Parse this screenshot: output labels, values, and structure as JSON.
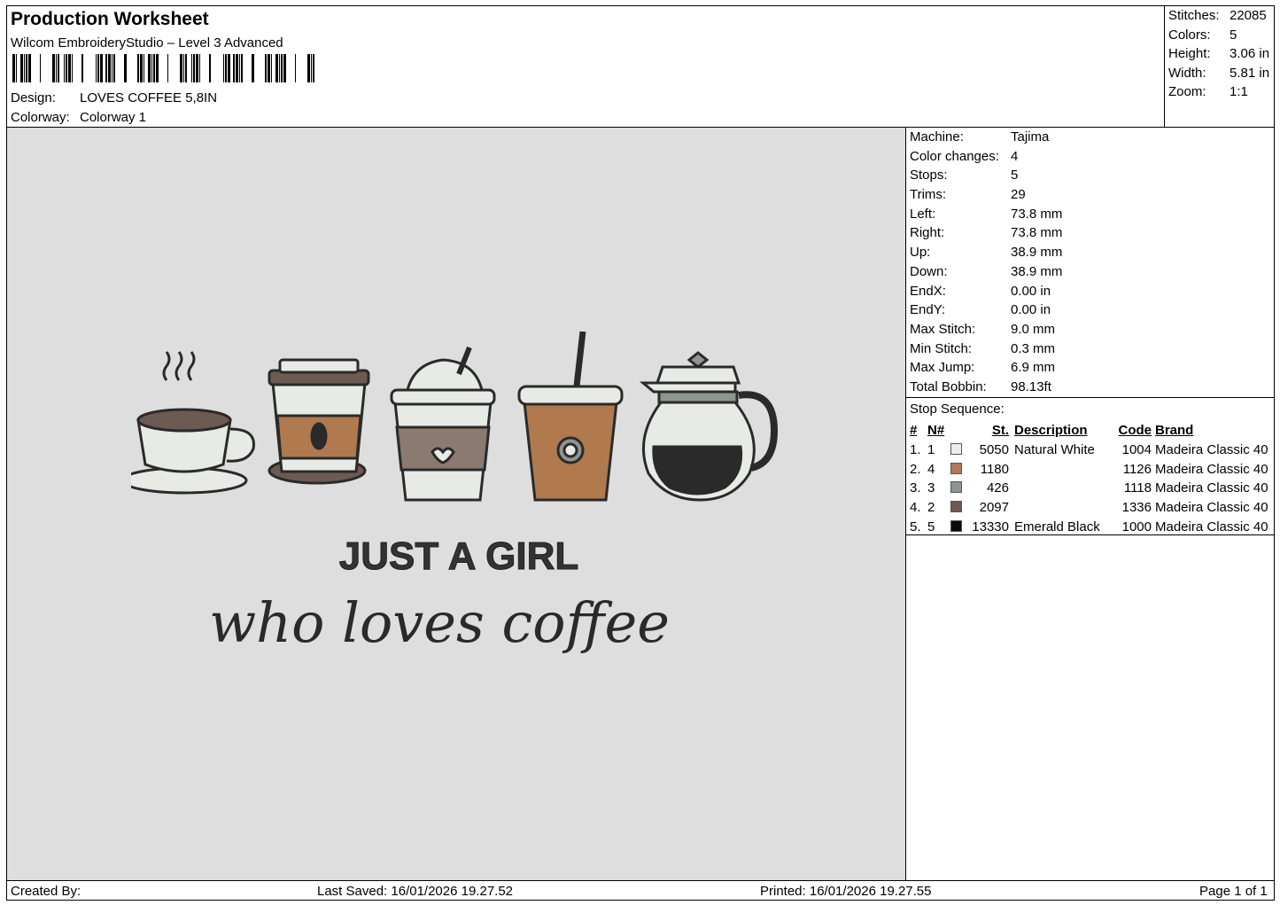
{
  "header": {
    "title": "Production Worksheet",
    "software": "Wilcom EmbroideryStudio – Level 3 Advanced",
    "design_label": "Design:",
    "design_value": "LOVES COFFEE 5,8IN",
    "colorway_label": "Colorway:",
    "colorway_value": "Colorway 1"
  },
  "stats": [
    {
      "label": "Stitches:",
      "value": "22085"
    },
    {
      "label": "Colors:",
      "value": "5"
    },
    {
      "label": "Height:",
      "value": "3.06 in"
    },
    {
      "label": "Width:",
      "value": "5.81 in"
    },
    {
      "label": "Zoom:",
      "value": "1:1"
    }
  ],
  "preview": {
    "line1": "JUST A GIRL",
    "line2": "who loves coffee",
    "colors": {
      "bg": "#dedede",
      "outline": "#2a2a2a",
      "white": "#e8eae6",
      "tan": "#b07a4e",
      "gray": "#8f968f",
      "brown": "#6d5a52",
      "black": "#111111"
    }
  },
  "machine_info": [
    {
      "label": "Machine:",
      "value": "Tajima"
    },
    {
      "label": "Color changes:",
      "value": "4"
    },
    {
      "label": "Stops:",
      "value": "5"
    },
    {
      "label": "Trims:",
      "value": "29"
    },
    {
      "label": "Left:",
      "value": "73.8 mm"
    },
    {
      "label": "Right:",
      "value": "73.8 mm"
    },
    {
      "label": "Up:",
      "value": "38.9 mm"
    },
    {
      "label": "Down:",
      "value": "38.9 mm"
    },
    {
      "label": "EndX:",
      "value": "0.00 in"
    },
    {
      "label": "EndY:",
      "value": "0.00 in"
    },
    {
      "label": "Max Stitch:",
      "value": "9.0 mm"
    },
    {
      "label": "Min Stitch:",
      "value": "0.3 mm"
    },
    {
      "label": "Max Jump:",
      "value": "6.9 mm"
    },
    {
      "label": "Total Bobbin:",
      "value": "98.13ft"
    }
  ],
  "stop_sequence": {
    "title": "Stop Sequence:",
    "headers": {
      "idx": "#",
      "n": "N#",
      "st": "St.",
      "desc": "Description",
      "code": "Code",
      "brand": "Brand"
    },
    "rows": [
      {
        "idx": "1.",
        "n": "1",
        "color": "#eceeec",
        "st": "5050",
        "desc": "Natural White",
        "code": "1004",
        "brand": "Madeira Classic 40"
      },
      {
        "idx": "2.",
        "n": "4",
        "color": "#b5785a",
        "st": "1180",
        "desc": "",
        "code": "1126",
        "brand": "Madeira Classic 40"
      },
      {
        "idx": "3.",
        "n": "3",
        "color": "#8e968f",
        "st": "426",
        "desc": "",
        "code": "1118",
        "brand": "Madeira Classic 40"
      },
      {
        "idx": "4.",
        "n": "2",
        "color": "#6e5a55",
        "st": "2097",
        "desc": "",
        "code": "1336",
        "brand": "Madeira Classic 40"
      },
      {
        "idx": "5.",
        "n": "5",
        "color": "#0a0a0a",
        "st": "13330",
        "desc": "Emerald Black",
        "code": "1000",
        "brand": "Madeira Classic 40"
      }
    ]
  },
  "footer": {
    "created_by": "Created By:",
    "last_saved": "Last Saved: 16/01/2026 19.27.52",
    "printed": "Printed: 16/01/2026 19.27.55",
    "page": "Page 1 of 1"
  }
}
